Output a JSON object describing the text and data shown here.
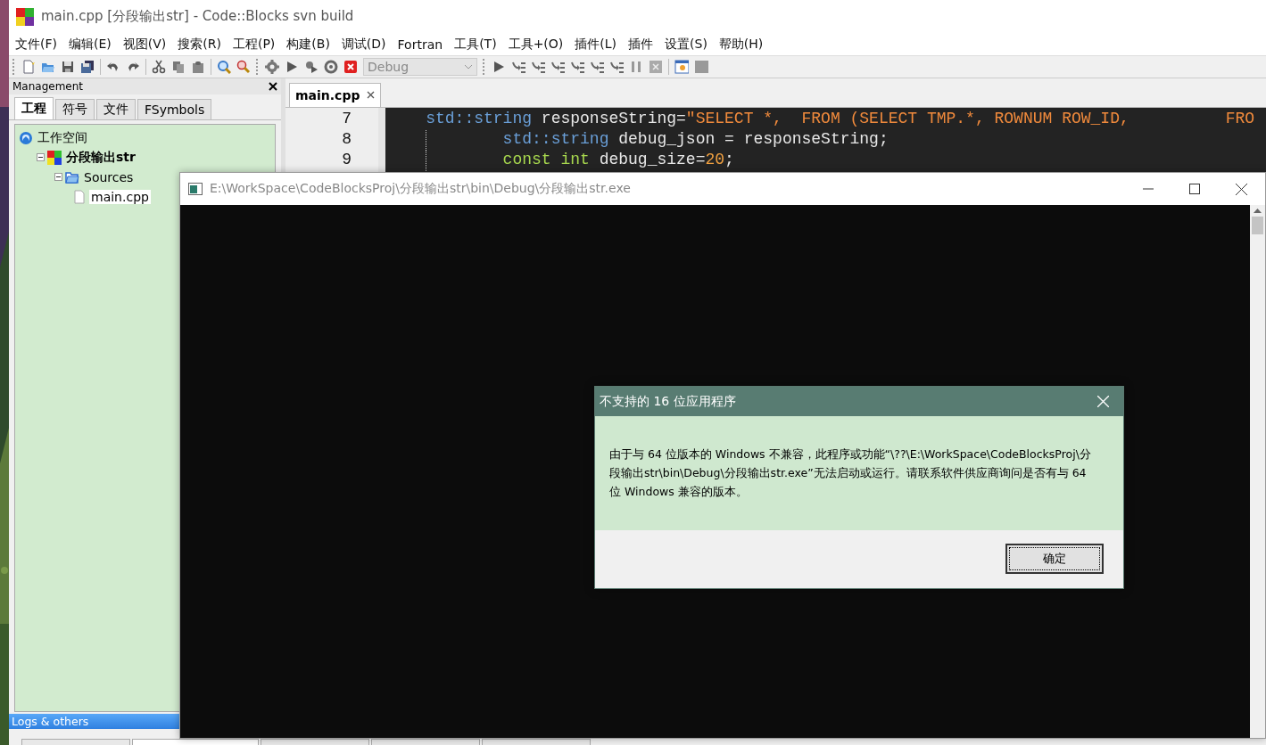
{
  "window": {
    "title": "main.cpp [分段输出str] - Code::Blocks svn build"
  },
  "menu": [
    "文件(F)",
    "编辑(E)",
    "视图(V)",
    "搜索(R)",
    "工程(P)",
    "构建(B)",
    "调试(D)",
    "Fortran",
    "工具(T)",
    "工具+(O)",
    "插件(L)",
    "插件",
    "设置(S)",
    "帮助(H)"
  ],
  "toolbar": {
    "build_target": {
      "value": "Debug",
      "disabled": true
    }
  },
  "management": {
    "title": "Management",
    "tabs": [
      {
        "label": "工程",
        "selected": true
      },
      {
        "label": "符号",
        "selected": false
      },
      {
        "label": "文件",
        "selected": false
      },
      {
        "label": "FSymbols",
        "selected": false
      }
    ],
    "tree": [
      {
        "label": "工作空间",
        "kind": "workspace",
        "selected": false,
        "children": [
          {
            "label": "分段输出str",
            "kind": "project",
            "selected": false,
            "expanded": true,
            "children": [
              {
                "label": "Sources",
                "kind": "folder",
                "selected": false,
                "expanded": true,
                "children": [
                  {
                    "label": "main.cpp",
                    "kind": "file",
                    "selected": true
                  }
                ]
              }
            ]
          }
        ]
      }
    ]
  },
  "editor": {
    "tabs": [
      {
        "label": "main.cpp",
        "selected": true
      }
    ],
    "lines": [
      {
        "number": "7",
        "tokens": [
          {
            "kind": "type",
            "text": "    std::string"
          },
          {
            "kind": "plain",
            "text": " responseString="
          },
          {
            "kind": "string",
            "text": "\"SELECT *,  FROM (SELECT TMP.*, ROWNUM ROW_ID,          FRO"
          }
        ]
      },
      {
        "number": "8",
        "tokens": [
          {
            "kind": "type",
            "text": "            std::string"
          },
          {
            "kind": "plain",
            "text": " debug_json = responseString;"
          }
        ]
      },
      {
        "number": "9",
        "tokens": [
          {
            "kind": "keyword",
            "text": "            const int"
          },
          {
            "kind": "plain",
            "text": " debug_size="
          },
          {
            "kind": "number",
            "text": "20"
          },
          {
            "kind": "plain",
            "text": ";"
          }
        ]
      }
    ]
  },
  "logs": {
    "title": "Logs & others",
    "tabs": [
      {
        "selected": false
      },
      {
        "selected": true
      },
      {
        "selected": false
      },
      {
        "selected": false
      },
      {
        "selected": false
      }
    ]
  },
  "console": {
    "title": "E:\\WorkSpace\\CodeBlocksProj\\分段输出str\\bin\\Debug\\分段输出str.exe",
    "active": false
  },
  "dialog": {
    "title": "不支持的 16 位应用程序",
    "message": "由于与 64 位版本的 Windows 不兼容，此程序或功能“\\??\\E:\\WorkSpace\\CodeBlocksProj\\分段输出str\\bin\\Debug\\分段输出str.exe”无法启动或运行。请联系软件供应商询问是否有与 64 位 Windows 兼容的版本。",
    "button": {
      "label": "确定",
      "focused": true
    }
  }
}
